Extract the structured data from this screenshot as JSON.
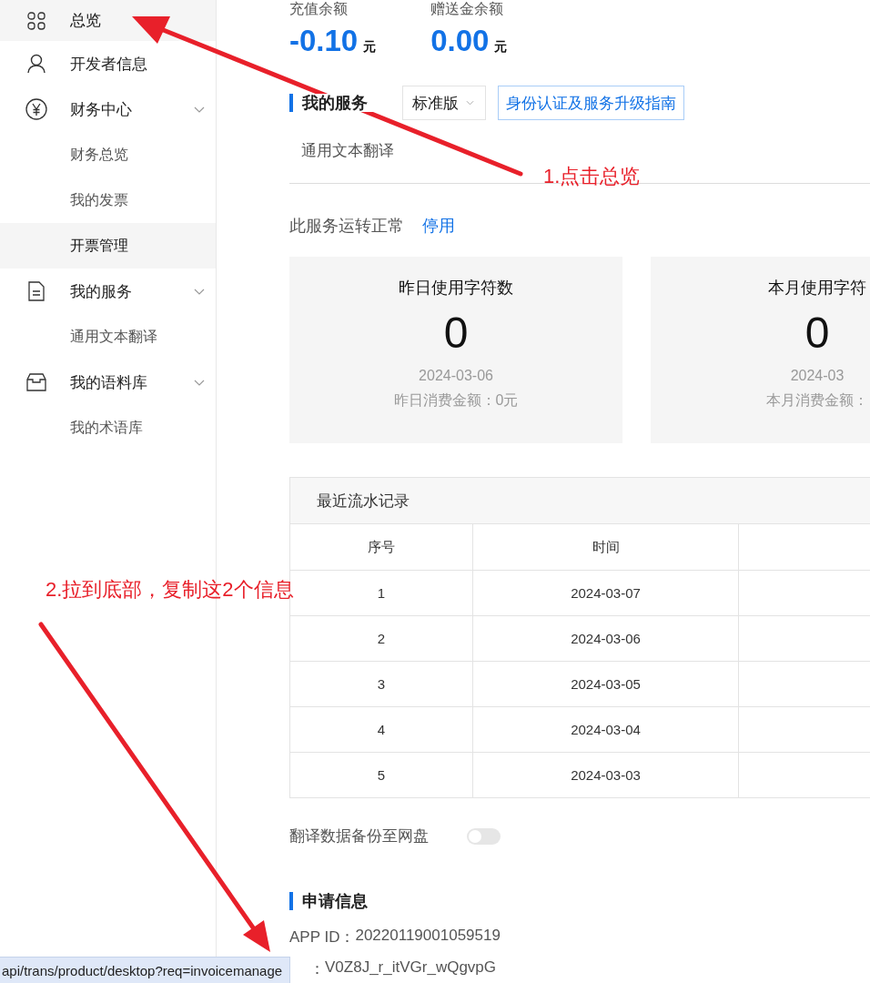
{
  "sidebar": {
    "items": [
      {
        "label": "总览",
        "selected": true
      },
      {
        "label": "开发者信息",
        "selected": false
      },
      {
        "label": "财务中心",
        "selected": false,
        "expanded": true,
        "children": [
          {
            "label": "财务总览",
            "selected": false
          },
          {
            "label": "我的发票",
            "selected": false
          },
          {
            "label": "开票管理",
            "selected": true
          }
        ]
      },
      {
        "label": "我的服务",
        "selected": false,
        "expanded": true,
        "children": [
          {
            "label": "通用文本翻译",
            "selected": false
          }
        ]
      },
      {
        "label": "我的语料库",
        "selected": false,
        "expanded": true,
        "children": [
          {
            "label": "我的术语库",
            "selected": false
          }
        ]
      }
    ]
  },
  "balances": [
    {
      "label": "充值余额",
      "amount": "-0.10",
      "unit": "元"
    },
    {
      "label": "赠送金余额",
      "amount": "0.00",
      "unit": "元"
    }
  ],
  "service": {
    "title": "我的服务",
    "edition": "标准版",
    "guide_link": "身份认证及服务升级指南",
    "tabs": [
      {
        "label": "通用文本翻译",
        "selected": false
      }
    ],
    "status": "此服务运转正常",
    "action": "停用"
  },
  "usage_cards": [
    {
      "title": "昨日使用字符数",
      "count": "0",
      "date": "2024-03-06",
      "cost": "昨日消费金额：0元"
    },
    {
      "title": "本月使用字符",
      "count": "0",
      "date": "2024-03",
      "cost": "本月消费金额："
    }
  ],
  "records": {
    "title": "最近流水记录",
    "columns": [
      "序号",
      "时间"
    ],
    "rows": [
      [
        "1",
        "2024-03-07"
      ],
      [
        "2",
        "2024-03-06"
      ],
      [
        "3",
        "2024-03-05"
      ],
      [
        "4",
        "2024-03-04"
      ],
      [
        "5",
        "2024-03-03"
      ]
    ]
  },
  "backup": {
    "label": "翻译数据备份至网盘",
    "on": false
  },
  "application": {
    "title": "申请信息",
    "fields": [
      {
        "label": "APP ID：",
        "value": "20220119001059519"
      },
      {
        "label": "：",
        "value": "V0Z8J_r_itVGr_wQgvpG"
      }
    ]
  },
  "status_bar": {
    "url": "api/trans/product/desktop?req=invoicemanage"
  },
  "annotations": [
    {
      "text": "1.点击总览"
    },
    {
      "text": "2.拉到底部，复制这2个信息"
    }
  ]
}
